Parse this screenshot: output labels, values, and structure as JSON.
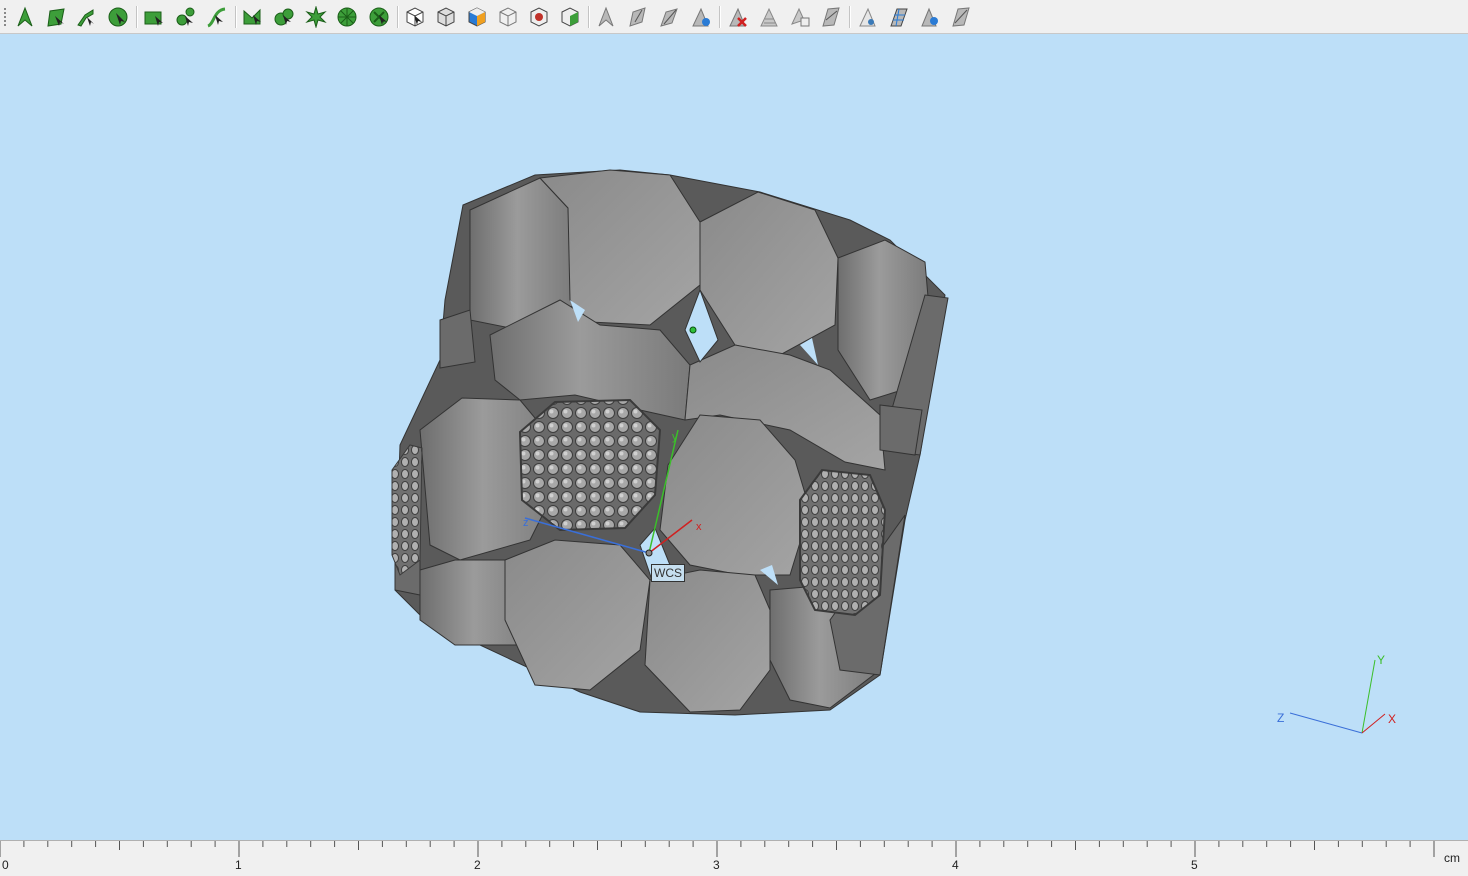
{
  "toolbar": {
    "groups": [
      {
        "name": "pick-tools",
        "items": [
          "pick-point-icon",
          "pick-face-icon",
          "pick-edge-icon",
          "pick-circle-center-icon"
        ]
      },
      {
        "name": "pick-more",
        "items": [
          "pick-area-icon",
          "pick-edge-midpoint-icon",
          "pick-curve-icon"
        ]
      },
      {
        "name": "pick-adv",
        "items": [
          "pick-wedge-icon",
          "pick-blend-icon",
          "pick-star-icon",
          "pick-polar-icon",
          "pick-cross-icon"
        ]
      },
      {
        "name": "view-tools",
        "items": [
          "view-cube-icon",
          "view-cube-shaded-icon",
          "view-cube-color-icon",
          "view-cube-wire-icon",
          "view-cube-red-icon",
          "view-cube-green-icon"
        ]
      },
      {
        "name": "axis-tools",
        "items": [
          "align-wcs-icon",
          "align-plane-icon",
          "align-axis-icon",
          "align-transform-icon"
        ]
      },
      {
        "name": "delete-tools",
        "items": [
          "delete-point-icon",
          "clear-selection-icon",
          "copy-face-icon",
          "face-plane-icon"
        ]
      },
      {
        "name": "mesh-tools",
        "items": [
          "mesh-face-icon",
          "mesh-grid-icon",
          "mesh-local-icon",
          "mesh-export-icon"
        ]
      }
    ]
  },
  "viewport": {
    "background_color": "#bddff8",
    "model_color": "#8f8f8f",
    "wcs_label": "WCS",
    "wcs_axes": {
      "x": "x",
      "y": "y",
      "z": "z"
    },
    "orientation_axes": {
      "x": "X",
      "y": "Y",
      "z": "Z"
    }
  },
  "ruler": {
    "unit": "cm",
    "labels": [
      "0",
      "1",
      "2",
      "3",
      "4",
      "5"
    ]
  }
}
